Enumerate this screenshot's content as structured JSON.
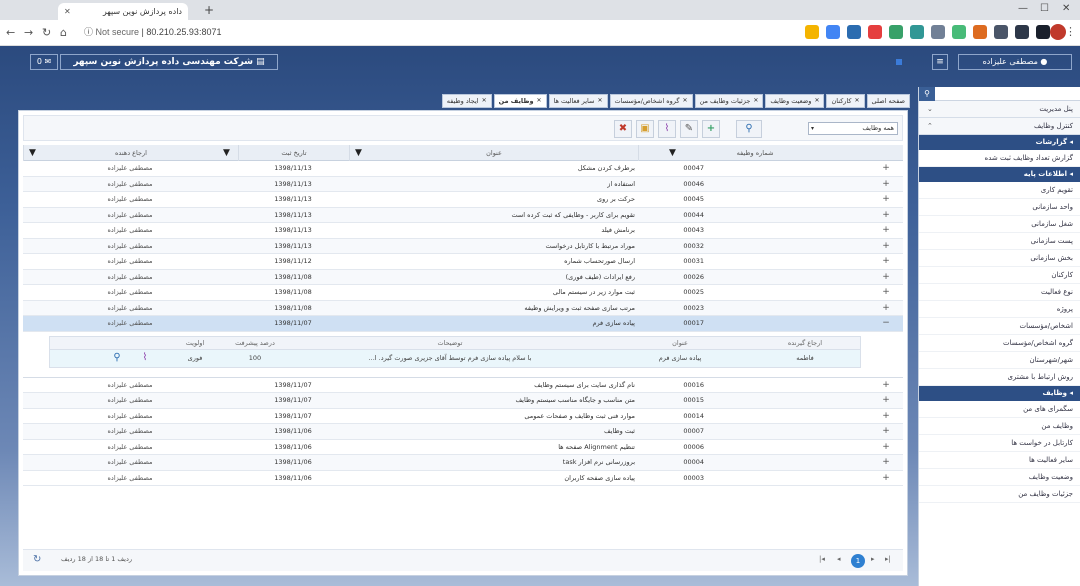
{
  "browser": {
    "tab_title": "داده پردازش نوین سپهر",
    "url_secure": "Not secure",
    "url_host": "80.210.25.93:8071"
  },
  "header": {
    "company": "شرکت مهندسی داده پردازش نوین سپهر",
    "mail_count": "0",
    "user_name": "مصطفی علیزاده"
  },
  "tabs": [
    {
      "label": "صفحه اصلی"
    },
    {
      "label": "کارکنان"
    },
    {
      "label": "وضعیت وظایف"
    },
    {
      "label": "جزئیات وظایف من"
    },
    {
      "label": "گروه اشخاص/مؤسسات"
    },
    {
      "label": "سایر فعالیت ها"
    },
    {
      "label": "وظایف من"
    },
    {
      "label": "ایجاد وظیفه"
    }
  ],
  "toolbar": {
    "filter_select": "همه وظایف"
  },
  "grid": {
    "headers": {
      "code": "شماره وظیفه",
      "title": "عنوان",
      "date": "تاریخ ثبت",
      "referrer": "ارجاع دهنده"
    },
    "rows": [
      {
        "code": "00047",
        "title": "برطرف کردن مشکل",
        "date": "1398/11/13",
        "referrer": "مصطفی علیزاده"
      },
      {
        "code": "00046",
        "title": "استفاده از",
        "date": "1398/11/13",
        "referrer": "مصطفی علیزاده"
      },
      {
        "code": "00045",
        "title": "حرکت بر روی",
        "date": "1398/11/13",
        "referrer": "مصطفی علیزاده"
      },
      {
        "code": "00044",
        "title": "تقویم برای کاربر - وظایفی که ثبت کرده است",
        "date": "1398/11/13",
        "referrer": "مصطفی علیزاده"
      },
      {
        "code": "00043",
        "title": "برنامش فیلد",
        "date": "1398/11/13",
        "referrer": "مصطفی علیزاده"
      },
      {
        "code": "00032",
        "title": "موراد مرتبط با کارتابل درخواست",
        "date": "1398/11/13",
        "referrer": "مصطفی علیزاده"
      },
      {
        "code": "00031",
        "title": "ارسال صورتحساب شماره",
        "date": "1398/11/12",
        "referrer": "مصطفی علیزاده"
      },
      {
        "code": "00026",
        "title": "رفع ایرادات (طیف فوری)",
        "date": "1398/11/08",
        "referrer": "مصطفی علیزاده"
      },
      {
        "code": "00025",
        "title": "ثبت موارد زیر در سیستم مالی",
        "date": "1398/11/08",
        "referrer": "مصطفی علیزاده"
      },
      {
        "code": "00023",
        "title": "مرتب سازی صفحه ثبت و ویرایش وظیفه",
        "date": "1398/11/08",
        "referrer": "مصطفی علیزاده"
      },
      {
        "code": "00017",
        "title": "پیاده سازی فرم",
        "date": "1398/11/07",
        "referrer": "مصطفی علیزاده"
      }
    ],
    "detail": {
      "headers": {
        "assignee": "ارجاع گیرنده",
        "title": "عنوان",
        "desc": "توضیحات",
        "progress": "درصد پیشرفت",
        "priority": "اولویت"
      },
      "assignee": "فاطمه",
      "title": "پیاده سازی فرم",
      "desc": "با سلام پیاده سازی فرم توسط آقای جزیری صورت گیرد. ا...",
      "progress": "100",
      "priority": "فوری"
    },
    "rows2": [
      {
        "code": "00016",
        "title": "نام گذاری سایت برای سیستم وظایف",
        "date": "1398/11/07",
        "referrer": "مصطفی علیزاده"
      },
      {
        "code": "00015",
        "title": "متن مناسب و جایگاه مناسب سیستم وظایف",
        "date": "1398/11/07",
        "referrer": "مصطفی علیزاده"
      },
      {
        "code": "00014",
        "title": "موارد فنی ثبت وظایف و صفحات عمومی",
        "date": "1398/11/07",
        "referrer": "مصطفی علیزاده"
      },
      {
        "code": "00007",
        "title": "ثبت وظایف",
        "date": "1398/11/06",
        "referrer": "مصطفی علیزاده"
      },
      {
        "code": "00006",
        "title": "تنظیم Alignment صفحه ها",
        "date": "1398/11/06",
        "referrer": "مصطفی علیزاده"
      },
      {
        "code": "00004",
        "title": "بروزرسانی نرم افزار task",
        "date": "1398/11/06",
        "referrer": "مصطفی علیزاده"
      },
      {
        "code": "00003",
        "title": "پیاده سازی صفحه کاربران",
        "date": "1398/11/06",
        "referrer": "مصطفی علیزاده"
      }
    ]
  },
  "pager": {
    "info": "ردیف 1 تا 18 از 18 ردیف",
    "current": "1"
  },
  "sidebar": {
    "top": [
      {
        "label": "پنل مدیریت"
      },
      {
        "label": "کنترل وظایف"
      }
    ],
    "sec_reports": "گزارشات",
    "reports": [
      {
        "label": "گزارش تعداد وظایف ثبت شده"
      }
    ],
    "sec_base": "اطلاعات پایه",
    "base": [
      {
        "label": "تقویم کاری"
      },
      {
        "label": "واحد سازمانی"
      },
      {
        "label": "شغل سازمانی"
      },
      {
        "label": "پست سازمانی"
      },
      {
        "label": "بخش سازمانی"
      },
      {
        "label": "کارکنان"
      },
      {
        "label": "نوع فعالیت"
      },
      {
        "label": "پروژه"
      },
      {
        "label": "اشخاص/مؤسسات"
      },
      {
        "label": "گروه اشخاص/مؤسسات"
      },
      {
        "label": "شهر/شهرستان"
      },
      {
        "label": "روش ارتباط با مشتری"
      }
    ],
    "sec_tasks": "وظایف",
    "tasks": [
      {
        "label": "سگمرای های من"
      },
      {
        "label": "وظایف من"
      },
      {
        "label": "کارتابل در خواست ها"
      },
      {
        "label": "سایر فعالیت ها"
      },
      {
        "label": "وضعیت وظایف"
      },
      {
        "label": "جزئیات وظایف من"
      }
    ]
  }
}
